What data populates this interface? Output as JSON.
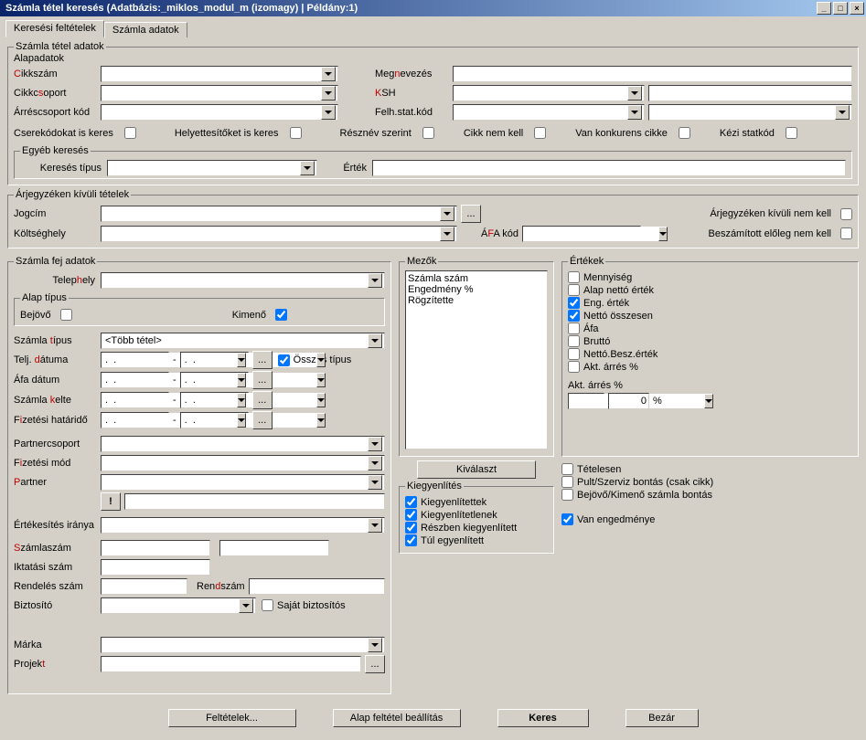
{
  "window": {
    "title": "Számla tétel keresés   (Adatbázis:_miklos_modul_m (izomagy) | Példány:1)"
  },
  "tabs": {
    "t0": "Keresési feltételek",
    "t1": "Számla adatok"
  },
  "grp": {
    "szamla_tetel": "Számla tétel adatok",
    "alapadatok": "Alapadatok",
    "egyeb": "Egyéb keresés",
    "arjegyzeken": "Árjegyzéken kívüli tételek",
    "szamla_fej": "Számla fej adatok",
    "alap_tipus": "Alap típus",
    "mezok": "Mezők",
    "ertekek": "Értékek",
    "kiegy": "Kiegyenlítés"
  },
  "lbl": {
    "cikkszam": "Cikkszám",
    "cikkcsoport": "Cikkcsoport",
    "arrescs": "Árréscsoport kód",
    "megnevezes": "Megnevezés",
    "ksh": "KSH",
    "felh": "Felh.stat.kód",
    "cserek": "Cserekódokat is keres",
    "helyett": "Helyettesítőket is keres",
    "reszn": "Résznév szerint",
    "cikknem": "Cikk nem kell",
    "vankonk": "Van konkurens cikke",
    "kezistat": "Kézi statkód",
    "keres_tipus": "Keresés típus",
    "ertek": "Érték",
    "jogcim": "Jogcím",
    "koltseghely": "Költséghely",
    "afakod": "ÁFA kód",
    "arjk_nemkell": "Árjegyzéken kívüli nem kell",
    "besz_eloleg": "Beszámított előleg nem kell",
    "telephely": "Telephely",
    "bejovo": "Bejövő",
    "kimeno": "Kimenő",
    "szamla_tipus": "Számla típus",
    "telj_datuma": "Telj. dátuma",
    "osszes_tipus": "Összes típus",
    "afa_datum": "Áfa dátum",
    "szamla_kelte": "Számla kelte",
    "fiz_hatarido": "Fizetési határidő",
    "partnercsoport": "Partnercsoport",
    "fizmod": "Fizetési mód",
    "partner": "Partner",
    "ert_iranya": "Értékesítés iránya",
    "szamlaszam": "Számlaszám",
    "iktatasi": "Iktatási szám",
    "rendeles": "Rendelés szám",
    "rendszam": "Rendszám",
    "biztosito": "Biztosító",
    "sajat_bizt": "Saját biztosítós",
    "marka": "Márka",
    "projekt": "Projekt",
    "kivalaszt": "Kiválaszt",
    "kiegy1": "Kiegyenlítettek",
    "kiegy2": "Kiegyenlítetlenek",
    "kiegy3": "Részben kiegyenlített",
    "kiegy4": "Túl egyenlített",
    "mennyiseg": "Mennyiség",
    "alap_netto": "Alap nettó érték",
    "eng_ertek": "Eng. érték",
    "netto_ossz": "Nettó összesen",
    "afa": "Áfa",
    "brutto": "Bruttó",
    "netto_besz": "Nettó.Besz.érték",
    "akt_arres": "Akt. árrés %",
    "akt_arres2": "Akt. árrés %",
    "tetelesen": "Tételesen",
    "pult_szerviz": "Pult/Szerviz bontás (csak cikk)",
    "bejo_kimen": "Bejövő/Kimenő számla bontás",
    "van_enged": "Van engedménye",
    "pct": "%",
    "zero": "0"
  },
  "val": {
    "szamla_tipus": "<Több tétel>",
    "date_empty": ".  .",
    "ellipsis": "...",
    "exclaim": "!"
  },
  "mezok_list": {
    "i0": "Számla szám",
    "i1": "Engedmény %",
    "i2": "Rögzítette"
  },
  "footer": {
    "feltetelek": "Feltételek...",
    "alap": "Alap feltétel beállítás",
    "keres": "Keres",
    "bezar": "Bezár"
  }
}
